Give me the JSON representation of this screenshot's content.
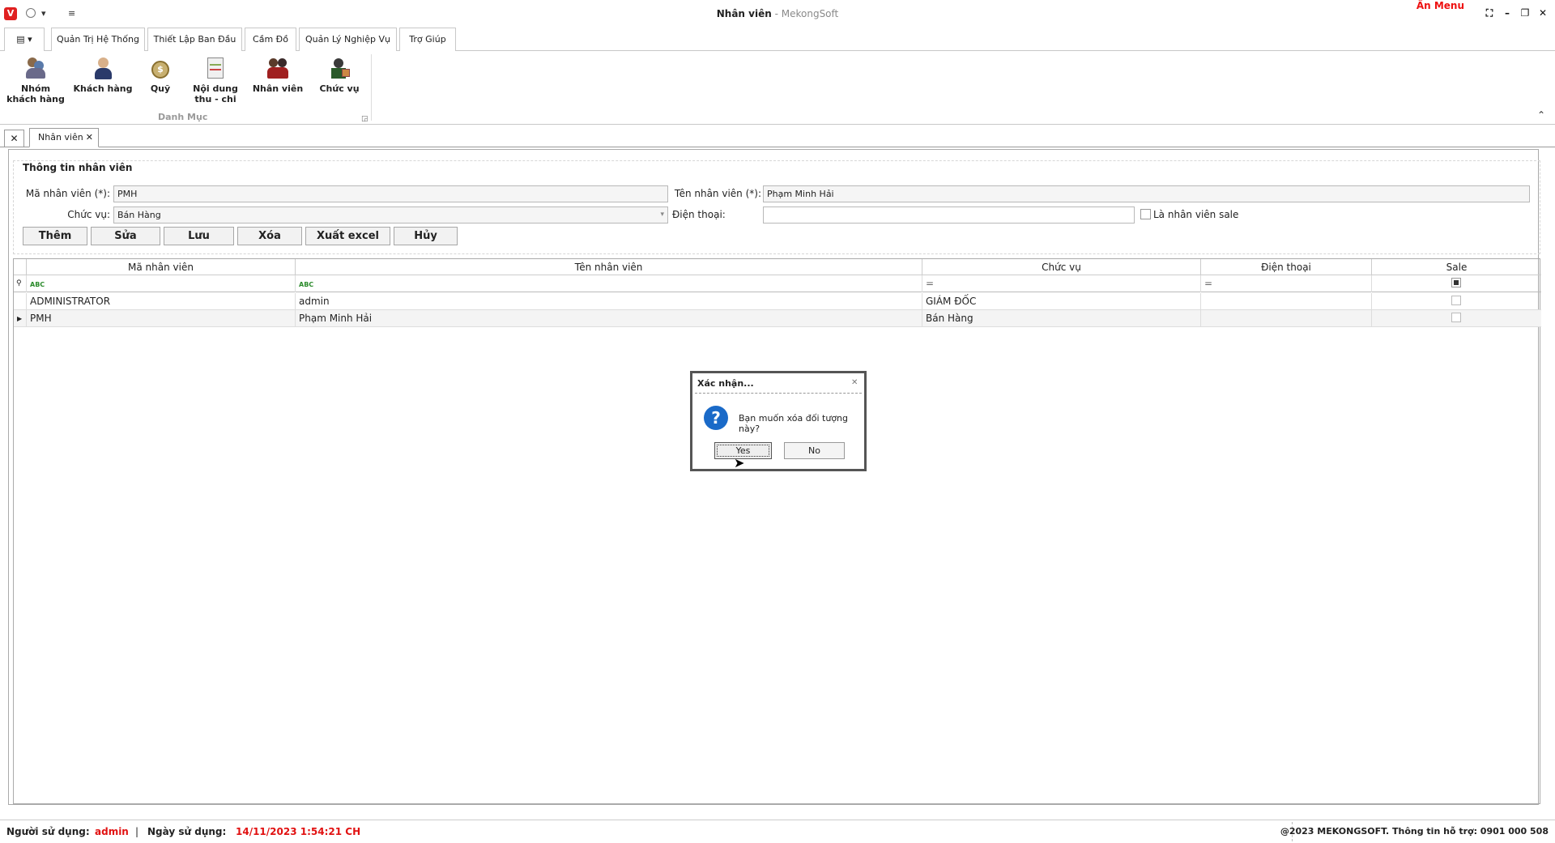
{
  "window": {
    "title": "Nhân viên",
    "app_suffix": " - MekongSoft",
    "hide_menu": "Ẩn Menu"
  },
  "ribbon_tabs": [
    "Quản Trị Hệ Thống",
    "Thiết Lập Ban Đầu",
    "Cầm Đồ",
    "Quản Lý Nghiệp Vụ",
    "Trợ Giúp"
  ],
  "active_tab": "Thiết Lập Ban Đầu",
  "ribbon": {
    "group": "Danh Mục",
    "buttons": [
      {
        "label": "Nhóm khách hàng",
        "icon": "customer-group-icon"
      },
      {
        "label": "Khách hàng",
        "icon": "customer-icon"
      },
      {
        "label": "Quỹ",
        "icon": "money-bag-icon"
      },
      {
        "label": "Nội dung thu - chi",
        "icon": "notepad-icon"
      },
      {
        "label": "Nhân viên",
        "icon": "staff-icon"
      },
      {
        "label": "Chức vụ",
        "icon": "position-icon"
      }
    ]
  },
  "doc_tab": {
    "label": "Nhân viên"
  },
  "form": {
    "section_title": "Thông tin nhân viên",
    "code_label": "Mã nhân viên (*):",
    "code_value": "PMH",
    "name_label": "Tên nhân viên (*):",
    "name_value": "Phạm Minh Hải",
    "position_label": "Chức vụ:",
    "position_value": "Bán Hàng",
    "phone_label": "Điện thoại:",
    "phone_value": "",
    "sale_label": "Là nhân viên sale",
    "buttons": {
      "add": "Thêm",
      "edit": "Sửa",
      "save": "Lưu",
      "delete": "Xóa",
      "export": "Xuất excel",
      "cancel": "Hủy"
    }
  },
  "grid": {
    "columns": [
      "Mã nhân viên",
      "Tên nhân viên",
      "Chức vụ",
      "Điện thoại",
      "Sale"
    ],
    "filter_glyph": "ABC",
    "filter_eq": "=",
    "rows": [
      {
        "code": "ADMINISTRATOR",
        "name": "admin",
        "position": "GIÁM ĐỐC",
        "phone": "",
        "sale": false
      },
      {
        "code": "PMH",
        "name": "Phạm Minh Hải",
        "position": "Bán Hàng",
        "phone": "",
        "sale": false
      }
    ]
  },
  "dialog": {
    "title": "Xác nhận...",
    "message": "Bạn muốn xóa đối tượng này?",
    "yes": "Yes",
    "no": "No"
  },
  "status": {
    "user_label": "Người sử dụng:",
    "user_value": "admin",
    "sep": "|",
    "date_label": "Ngày sử dụng:",
    "date_value": "14/11/2023 1:54:21 CH",
    "copyright": "@2023 MEKONGSOFT. Thông tin hỗ trợ: 0901 000 508"
  },
  "colors": {
    "accent_red": "#e11111",
    "status_red": "#e11111"
  }
}
